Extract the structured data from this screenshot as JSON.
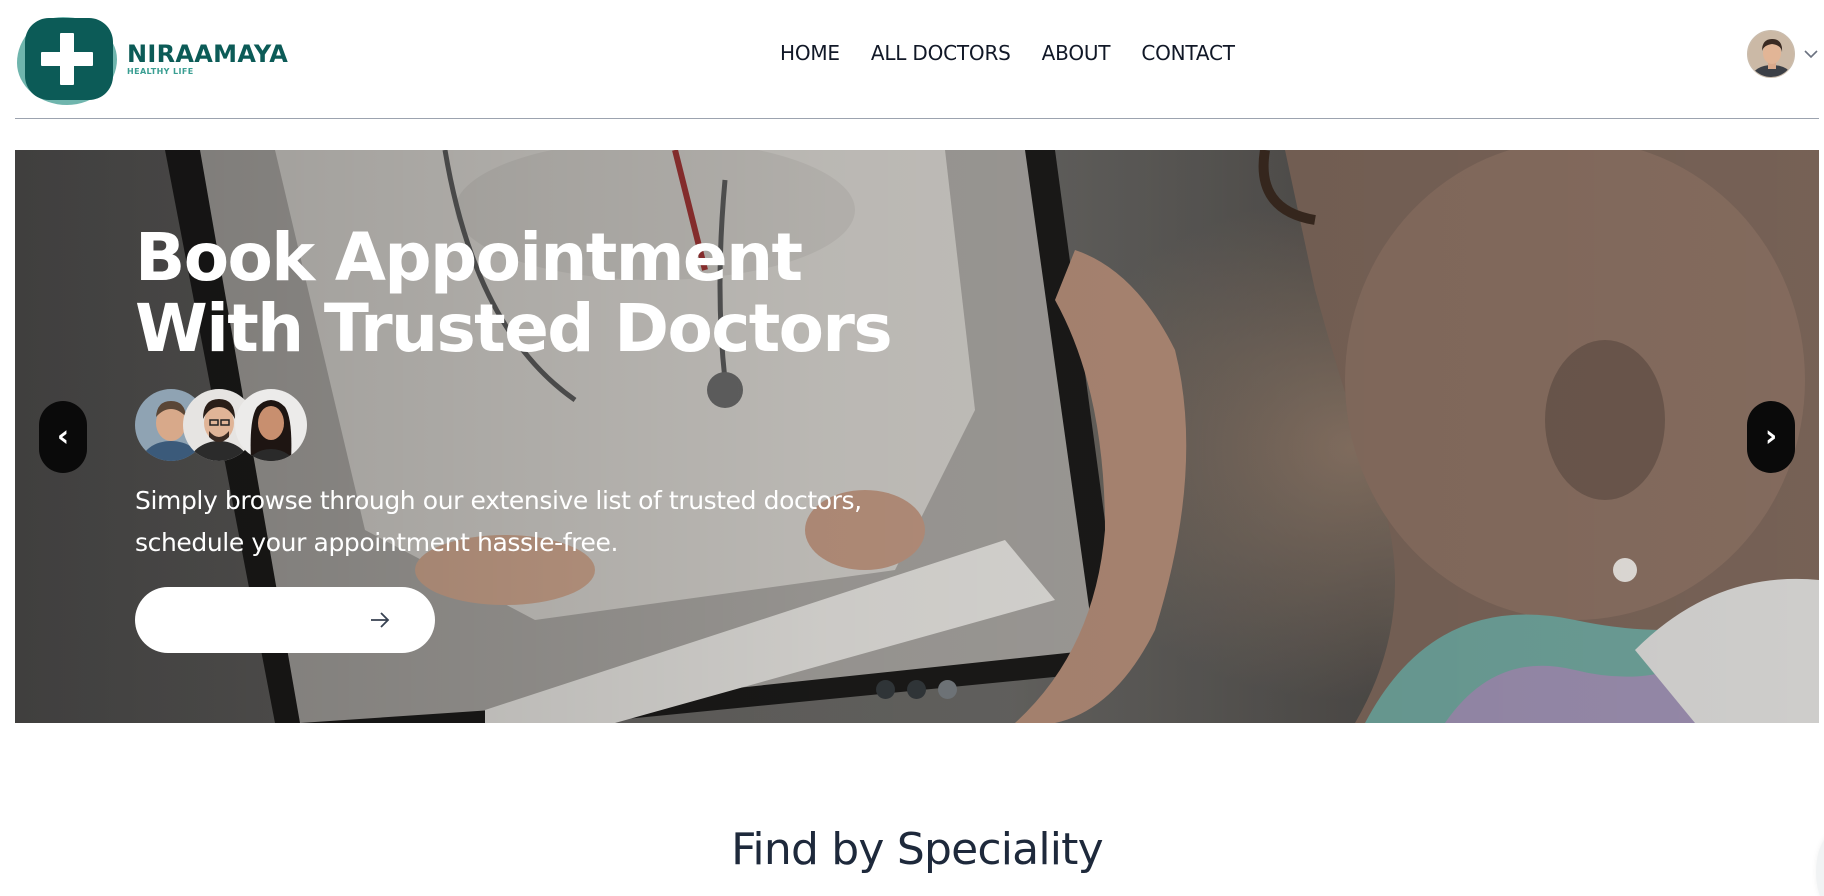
{
  "brand": {
    "name": "NIRAAMAYA",
    "tagline": "HEALTHY LIFE",
    "colors": {
      "primary": "#0c5b57",
      "secondary": "#6fb5ad",
      "accent": "#3a9e92"
    }
  },
  "nav": {
    "items": [
      {
        "label": "HOME"
      },
      {
        "label": "ALL DOCTORS"
      },
      {
        "label": "ABOUT"
      },
      {
        "label": "CONTACT"
      }
    ]
  },
  "profile": {
    "avatar_icon": "user-avatar",
    "dropdown_icon": "chevron-down-icon"
  },
  "hero": {
    "title_line1": "Book Appointment",
    "title_line2": "With Trusted Doctors",
    "description_line1": "Simply browse through our extensive list of trusted doctors,",
    "description_line2": "schedule your appointment hassle-free.",
    "cta_label": "",
    "cta_icon": "arrow-right-icon",
    "prev_icon": "chevron-left-icon",
    "next_icon": "chevron-right-icon",
    "prev_glyph": "‹",
    "next_glyph": "›",
    "slides_total": 3,
    "active_slide": 3
  },
  "section": {
    "title": "Find by Speciality"
  }
}
